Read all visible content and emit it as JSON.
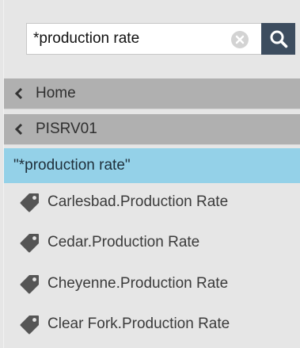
{
  "search": {
    "value": "*production rate"
  },
  "nav": {
    "home_label": "Home",
    "server_label": "PISRV01"
  },
  "query": {
    "label": "\"*production rate\""
  },
  "results": [
    {
      "label": "Carlesbad.Production Rate",
      "icon": "tag-icon"
    },
    {
      "label": "Cedar.Production Rate",
      "icon": "tag-icon"
    },
    {
      "label": "Cheyenne.Production Rate",
      "icon": "tag-icon"
    },
    {
      "label": "Clear Fork.Production Rate",
      "icon": "tag-icon"
    }
  ],
  "colors": {
    "panel_background": "#e6e6e6",
    "nav_background": "#b0b0b0",
    "query_highlight": "#94d1e8",
    "search_button": "#3d4d5f"
  }
}
